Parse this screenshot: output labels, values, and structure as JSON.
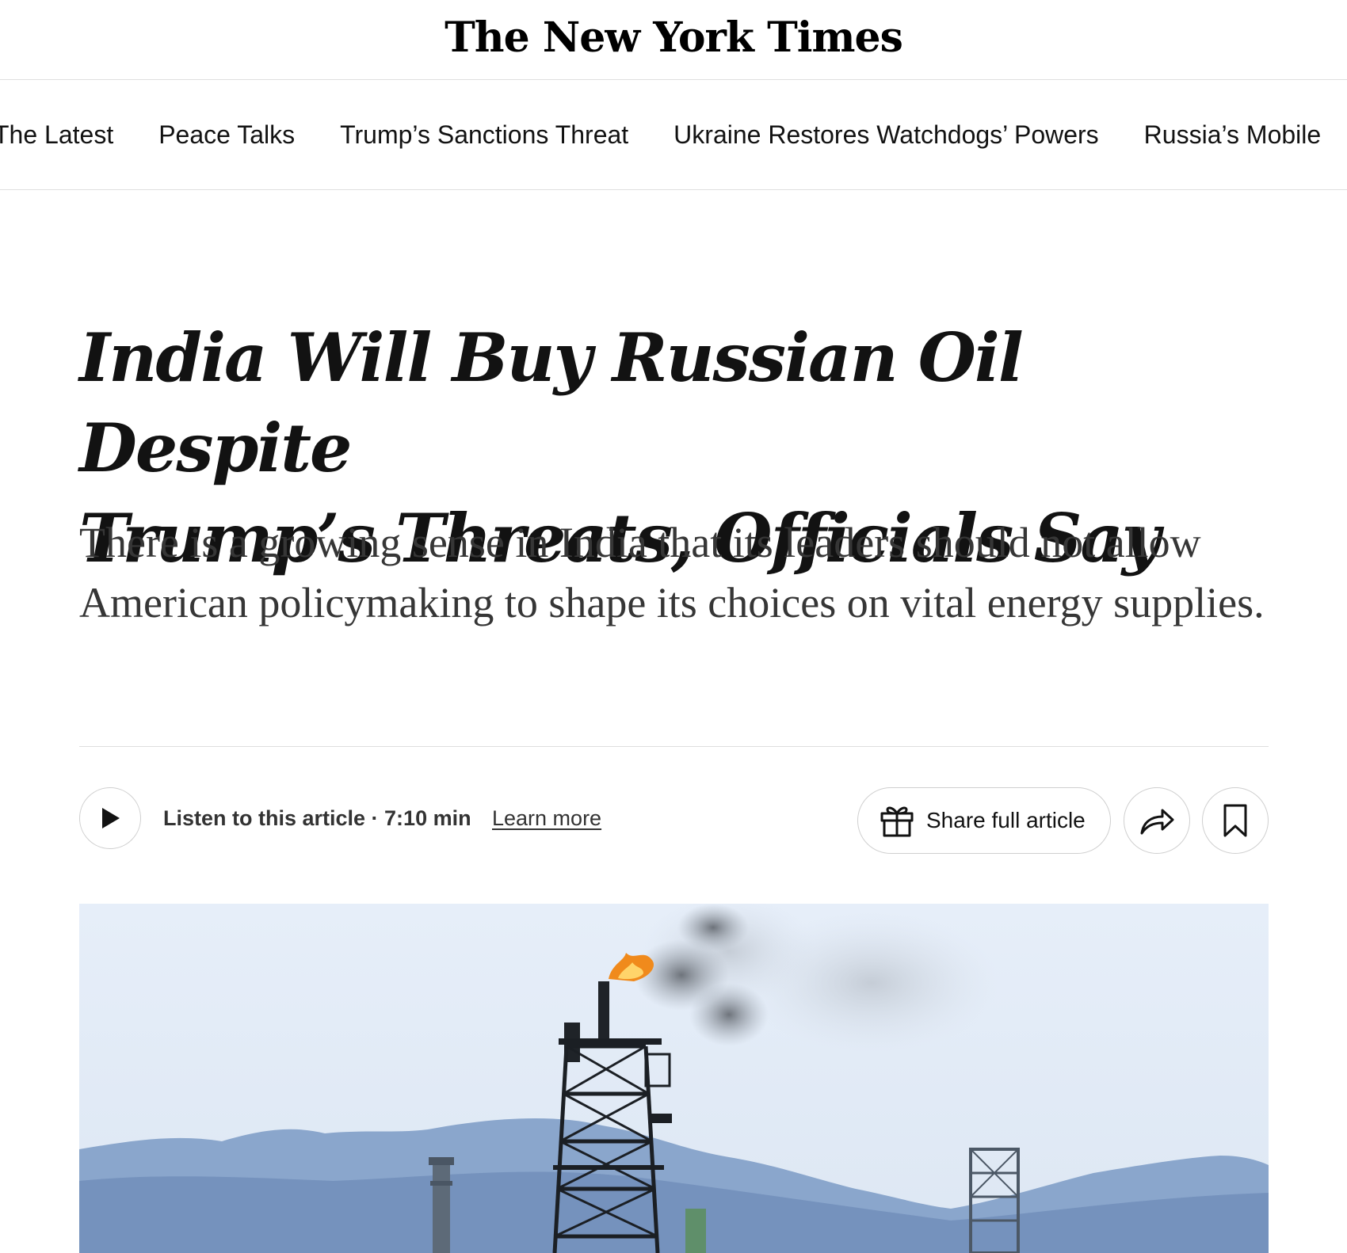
{
  "masthead": {
    "logo_text": "The New York Times"
  },
  "subnav": {
    "items": [
      {
        "label": "The Latest"
      },
      {
        "label": "Peace Talks"
      },
      {
        "label": "Trump’s Sanctions Threat"
      },
      {
        "label": "Ukraine Restores Watchdogs’ Powers"
      },
      {
        "label": "Russia’s Mobile"
      }
    ]
  },
  "article": {
    "headline_line1": "India Will Buy Russian Oil Despite",
    "headline_line2": "Trump’s Threats, Officials Say",
    "summary": "There is a growing sense in India that its leaders should not allow American policymaking to shape its choices on vital energy supplies."
  },
  "toolbar": {
    "listen_label": "Listen to this article · 7:10 min",
    "learn_more": "Learn more",
    "share_full_label": "Share full article"
  },
  "icons": {
    "play": "play-icon",
    "gift": "gift-icon",
    "share": "share-arrow-icon",
    "bookmark": "bookmark-icon"
  },
  "colors": {
    "text": "#121212",
    "summary_text": "#363636",
    "divider": "#dfdfdf",
    "sky": "#e4edf8",
    "hills": "#7f9ec7"
  }
}
